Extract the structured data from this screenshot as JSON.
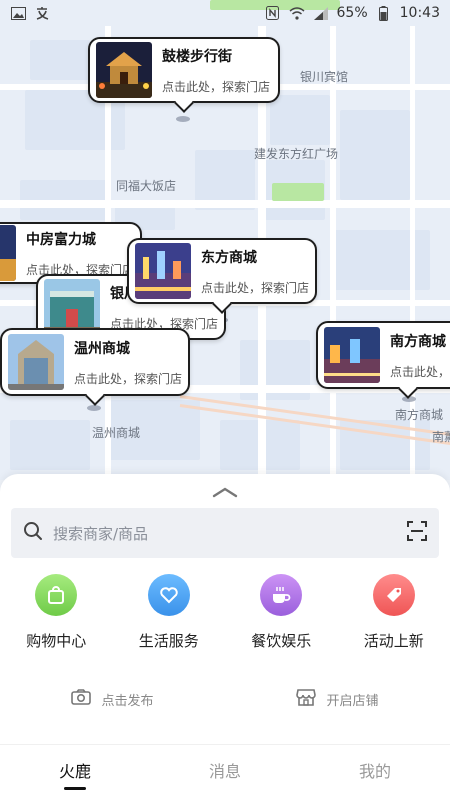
{
  "status_bar": {
    "battery": "65%",
    "time": "10:43"
  },
  "map": {
    "labels": {
      "yinchuan_hotel": "银川宾馆",
      "jianfa_square": "建发东方红广场",
      "tongfu_restaurant": "同福大饭店",
      "wenzhou_mall": "温州商城",
      "nanfang_mall": "南方商城",
      "nan_partial": "南薰"
    },
    "callouts": [
      {
        "title": "鼓楼步行街",
        "sub": "点击此处，探索门店"
      },
      {
        "title": "中房富力城",
        "sub": "点击此处，探索门店"
      },
      {
        "title": "东方商城",
        "sub": "点击此处，探索门店"
      },
      {
        "title": "银川",
        "sub": "点击此处，探索门店"
      },
      {
        "title": "温州商城",
        "sub": "点击此处，探索门店"
      },
      {
        "title": "南方商城",
        "sub": "点击此处，探"
      }
    ]
  },
  "sheet": {
    "search_placeholder": "搜索商家/商品",
    "categories": [
      {
        "label": "购物中心",
        "icon": "shopping-bag-icon",
        "color": "#8bdc62"
      },
      {
        "label": "生活服务",
        "icon": "heart-icon",
        "color": "#4ea8f5"
      },
      {
        "label": "餐饮娱乐",
        "icon": "coffee-cup-icon",
        "color": "#b57be9"
      },
      {
        "label": "活动上新",
        "icon": "tag-icon",
        "color": "#f56f6f"
      }
    ],
    "actions": [
      {
        "label": "点击发布",
        "icon": "camera-icon"
      },
      {
        "label": "开启店铺",
        "icon": "store-icon"
      }
    ]
  },
  "nav": {
    "tabs": [
      {
        "label": "火鹿",
        "active": true
      },
      {
        "label": "消息",
        "active": false
      },
      {
        "label": "我的",
        "active": false
      }
    ]
  }
}
